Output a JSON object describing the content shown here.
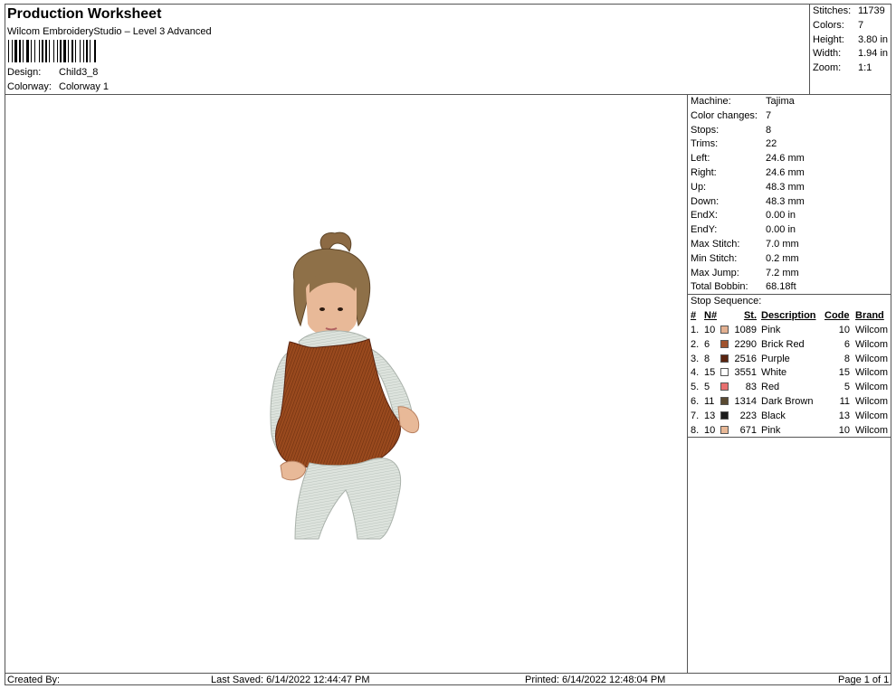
{
  "header": {
    "title": "Production Worksheet",
    "subtitle": "Wilcom EmbroideryStudio – Level 3 Advanced",
    "design_label": "Design:",
    "design_value": "Child3_8",
    "colorway_label": "Colorway:",
    "colorway_value": "Colorway 1"
  },
  "summary": {
    "stitches_label": "Stitches:",
    "stitches_value": "11739",
    "colors_label": "Colors:",
    "colors_value": "7",
    "height_label": "Height:",
    "height_value": "3.80 in",
    "width_label": "Width:",
    "width_value": "1.94 in",
    "zoom_label": "Zoom:",
    "zoom_value": "1:1"
  },
  "machine_info": [
    {
      "label": "Machine:",
      "value": "Tajima"
    },
    {
      "label": "Color changes:",
      "value": "7"
    },
    {
      "label": "Stops:",
      "value": "8"
    },
    {
      "label": "Trims:",
      "value": "22"
    },
    {
      "label": "Left:",
      "value": "24.6 mm"
    },
    {
      "label": "Right:",
      "value": "24.6 mm"
    },
    {
      "label": "Up:",
      "value": "48.3 mm"
    },
    {
      "label": "Down:",
      "value": "48.3 mm"
    },
    {
      "label": "EndX:",
      "value": "0.00 in"
    },
    {
      "label": "EndY:",
      "value": "0.00 in"
    },
    {
      "label": "Max Stitch:",
      "value": "7.0 mm"
    },
    {
      "label": "Min Stitch:",
      "value": "0.2 mm"
    },
    {
      "label": "Max Jump:",
      "value": "7.2 mm"
    },
    {
      "label": "Total Bobbin:",
      "value": "68.18ft"
    }
  ],
  "stop_sequence": {
    "title": "Stop Sequence:",
    "headers": {
      "num": "#",
      "n": "N#",
      "st": "St.",
      "description": "Description",
      "code": "Code",
      "brand": "Brand"
    },
    "rows": [
      {
        "num": "1.",
        "n": "10",
        "color": "#e3b091",
        "st": "1089",
        "description": "Pink",
        "code": "10",
        "brand": "Wilcom"
      },
      {
        "num": "2.",
        "n": "6",
        "color": "#a0522d",
        "st": "2290",
        "description": "Brick Red",
        "code": "6",
        "brand": "Wilcom"
      },
      {
        "num": "3.",
        "n": "8",
        "color": "#5a2410",
        "st": "2516",
        "description": "Purple",
        "code": "8",
        "brand": "Wilcom"
      },
      {
        "num": "4.",
        "n": "15",
        "color": "#ffffff",
        "st": "3551",
        "description": "White",
        "code": "15",
        "brand": "Wilcom"
      },
      {
        "num": "5.",
        "n": "5",
        "color": "#e87070",
        "st": "83",
        "description": "Red",
        "code": "5",
        "brand": "Wilcom"
      },
      {
        "num": "6.",
        "n": "11",
        "color": "#5a4a32",
        "st": "1314",
        "description": "Dark Brown",
        "code": "11",
        "brand": "Wilcom"
      },
      {
        "num": "7.",
        "n": "13",
        "color": "#1a1a1a",
        "st": "223",
        "description": "Black",
        "code": "13",
        "brand": "Wilcom"
      },
      {
        "num": "8.",
        "n": "10",
        "color": "#e8b896",
        "st": "671",
        "description": "Pink",
        "code": "10",
        "brand": "Wilcom"
      }
    ]
  },
  "footer": {
    "created_by": "Created By:",
    "last_saved": "Last Saved: 6/14/2022 12:44:47 PM",
    "printed": "Printed: 6/14/2022 12:48:04 PM",
    "page": "Page 1 of 1"
  }
}
